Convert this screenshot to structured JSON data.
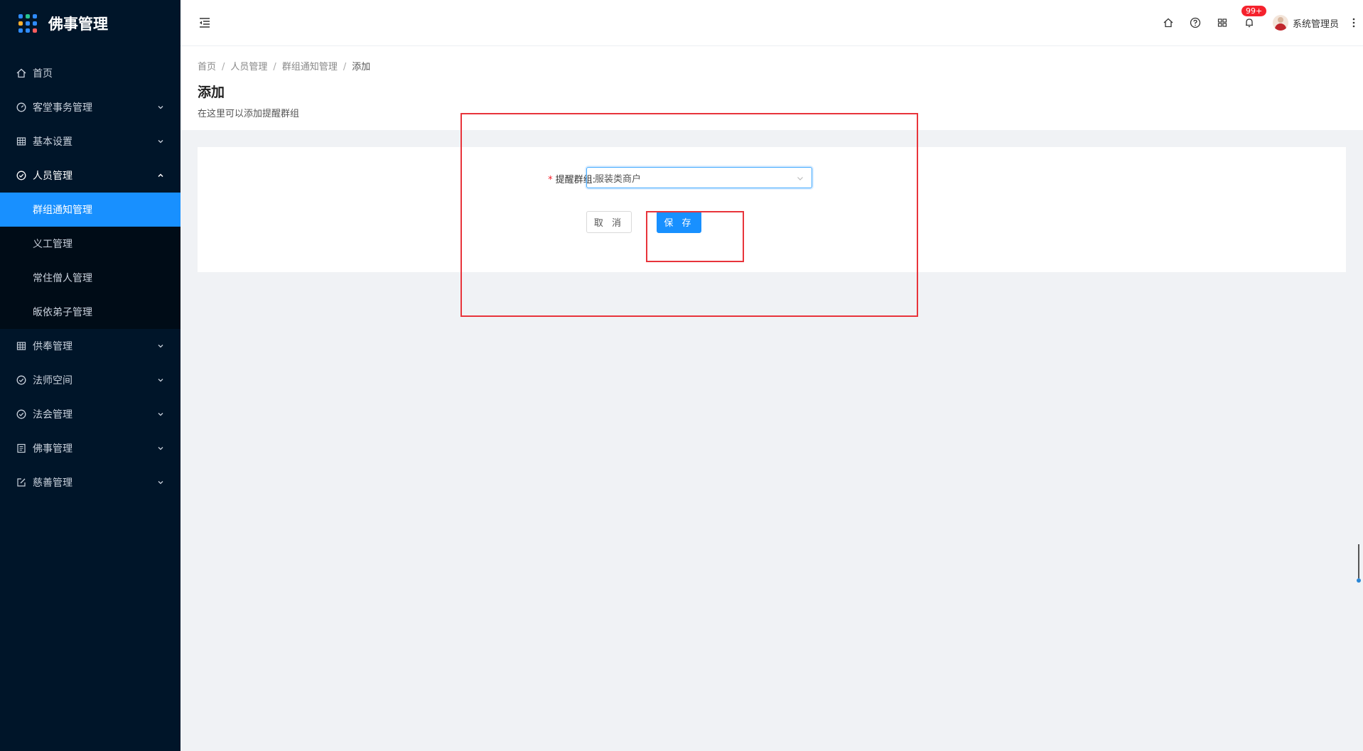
{
  "app": {
    "title": "佛事管理"
  },
  "sidebar": {
    "items": [
      {
        "label": "首页",
        "icon": "home-icon",
        "has_arrow": false
      },
      {
        "label": "客堂事务管理",
        "icon": "dashboard-icon",
        "has_arrow": true
      },
      {
        "label": "基本设置",
        "icon": "table-icon",
        "has_arrow": true
      },
      {
        "label": "人员管理",
        "icon": "check-circle-icon",
        "has_arrow": true,
        "open": true,
        "children": [
          {
            "label": "群组通知管理",
            "active": true
          },
          {
            "label": "义工管理"
          },
          {
            "label": "常住僧人管理"
          },
          {
            "label": "皈依弟子管理"
          }
        ]
      },
      {
        "label": "供奉管理",
        "icon": "table-icon",
        "has_arrow": true
      },
      {
        "label": "法师空间",
        "icon": "check-circle-icon",
        "has_arrow": true
      },
      {
        "label": "法会管理",
        "icon": "check-circle-icon",
        "has_arrow": true
      },
      {
        "label": "佛事管理",
        "icon": "profile-icon",
        "has_arrow": true
      },
      {
        "label": "慈善管理",
        "icon": "edit-icon",
        "has_arrow": true
      }
    ]
  },
  "header": {
    "notification_badge": "99+",
    "user_name": "系统管理员",
    "icons": [
      "home-icon",
      "question-icon",
      "apps-icon",
      "bell-icon"
    ]
  },
  "breadcrumb": [
    "首页",
    "人员管理",
    "群组通知管理",
    "添加"
  ],
  "page": {
    "title": "添加",
    "description": "在这里可以添加提醒群组"
  },
  "form": {
    "group_label": "提醒群组",
    "group_value": "服装类商户",
    "cancel_label": "取 消",
    "save_label": "保 存"
  },
  "colors": {
    "sidebar_bg": "#001529",
    "accent": "#1890ff",
    "annotation": "#e8343b"
  }
}
